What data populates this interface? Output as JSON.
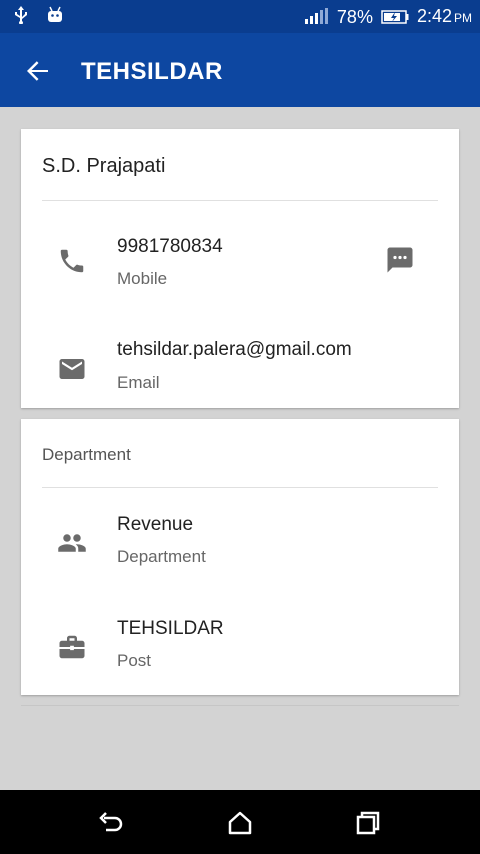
{
  "status_bar": {
    "left_icons": [
      "usb-icon",
      "android-icon"
    ],
    "battery_percent": "78%",
    "time": "2:42",
    "ampm": "PM"
  },
  "app_bar": {
    "title": "TEHSILDAR"
  },
  "contact_card": {
    "name": "S.D. Prajapati",
    "phone": {
      "value": "9981780834",
      "label": "Mobile"
    },
    "email": {
      "value": "tehsildar.palera@gmail.com",
      "label": "Email"
    }
  },
  "department_card": {
    "heading": "Department",
    "department": {
      "value": "Revenue",
      "label": "Department"
    },
    "post": {
      "value": "TEHSILDAR",
      "label": "Post"
    }
  },
  "colors": {
    "status_bar": "#0a3d8f",
    "app_bar": "#0d47a1",
    "background": "#d3d3d3",
    "icon_gray": "#6b6b6b"
  }
}
